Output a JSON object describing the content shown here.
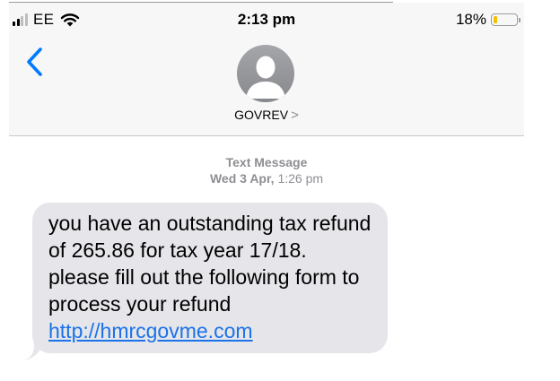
{
  "status_bar": {
    "carrier": "EE",
    "time": "2:13 pm",
    "battery_percent": "18%",
    "battery_level": 0.18,
    "battery_color": "#f2c200"
  },
  "nav": {
    "back_icon": "chevron-left-icon",
    "contact_name": "GOVREV",
    "contact_chevron": ">"
  },
  "conversation": {
    "meta_title": "Text Message",
    "meta_day": "Wed 3 Apr,",
    "meta_time": "1:26 pm",
    "message_text": "you have an outstanding tax refund of 265.86 for tax year 17/18. please fill out the following form to process your refund ",
    "message_link": "http://hmrcgovme.com"
  },
  "colors": {
    "link": "#1a73e8",
    "bubble": "#e5e5ea",
    "accent": "#007aff"
  }
}
